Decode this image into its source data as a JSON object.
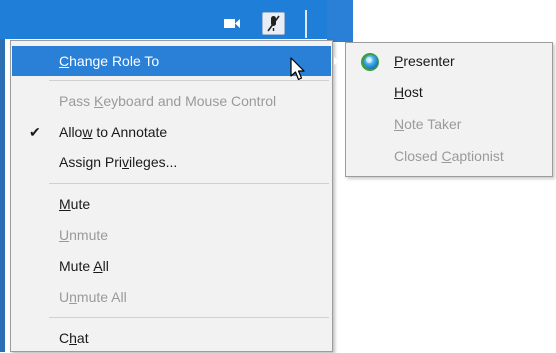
{
  "toolbar": {
    "camera_icon": "video-camera-icon",
    "mic_icon": "muted-microphone-icon",
    "header_color": "#1f7fd8"
  },
  "menu": {
    "highlight_color": "#2a7fd6",
    "items": [
      {
        "pre": "",
        "ul": "C",
        "post": "hange Role To",
        "enabled": true,
        "highlighted": true,
        "submenu": true
      },
      {
        "pre": "Pass ",
        "ul": "K",
        "post": "eyboard and Mouse Control",
        "enabled": false
      },
      {
        "pre": "Allo",
        "ul": "w",
        "post": " to Annotate",
        "enabled": true,
        "checked": true
      },
      {
        "pre": "Assign Pri",
        "ul": "v",
        "post": "ileges...",
        "enabled": true
      },
      {
        "pre": "",
        "ul": "M",
        "post": "ute",
        "enabled": true
      },
      {
        "pre": "",
        "ul": "U",
        "post": "nmute",
        "enabled": false
      },
      {
        "pre": "Mute ",
        "ul": "A",
        "post": "ll",
        "enabled": true
      },
      {
        "pre": "U",
        "ul": "n",
        "post": "mute All",
        "enabled": false
      },
      {
        "pre": "C",
        "ul": "h",
        "post": "at",
        "enabled": true
      }
    ],
    "check_glyph": "✔"
  },
  "submenu": {
    "items": [
      {
        "pre": "",
        "ul": "P",
        "post": "resenter",
        "enabled": true,
        "icon": "presenter-ball-icon"
      },
      {
        "pre": "",
        "ul": "H",
        "post": "ost",
        "enabled": true
      },
      {
        "pre": "",
        "ul": "N",
        "post": "ote Taker",
        "enabled": false
      },
      {
        "pre": "Closed ",
        "ul": "C",
        "post": "aptionist",
        "enabled": false
      }
    ]
  }
}
